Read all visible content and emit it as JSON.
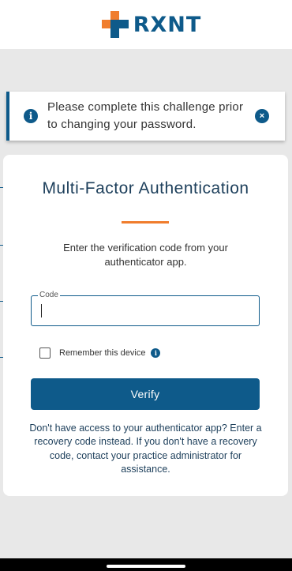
{
  "brand": {
    "name": "RXNT",
    "primary_color": "#0e5a8a",
    "accent_color": "#f07d2d",
    "text_color": "#1d3f5b"
  },
  "alert": {
    "message": "Please complete this challenge prior to changing your password.",
    "info_icon": "i",
    "close_icon": "×"
  },
  "mfa": {
    "title": "Multi-Factor Authentication",
    "subtitle": "Enter the verification code from your authenticator app.",
    "code_label": "Code",
    "code_value": "",
    "remember_label": "Remember this device",
    "remember_checked": false,
    "info_icon": "i",
    "verify_label": "Verify",
    "help_text": "Don't have access to your authenticator app? Enter a recovery code instead. If you don't have a recovery code, contact your practice administrator for assistance."
  }
}
